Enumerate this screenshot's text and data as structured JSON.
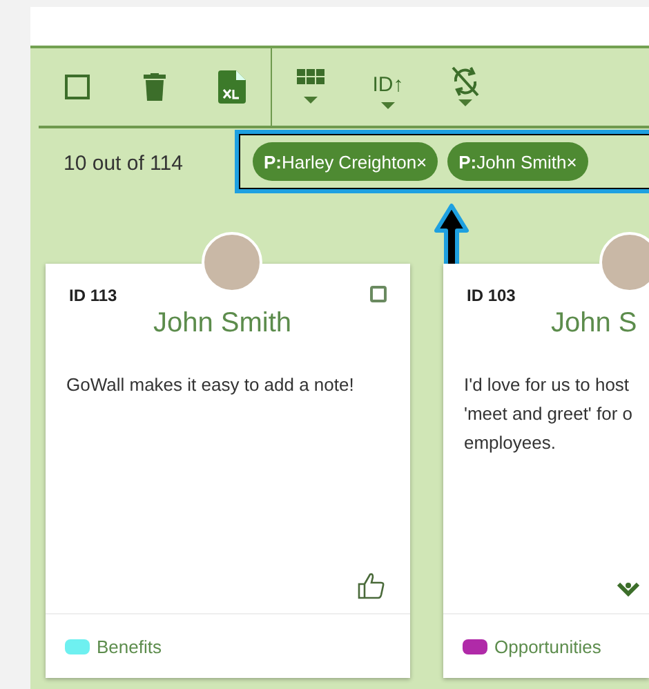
{
  "toolbar": {
    "select_all_checked": false,
    "sort_label": "ID↑"
  },
  "result_count": "10 out of 114",
  "filters": [
    {
      "prefix": "P:",
      "name": "Harley Creighton",
      "remove": "×"
    },
    {
      "prefix": "P:",
      "name": "John Smith",
      "remove": "×"
    }
  ],
  "cards": [
    {
      "id": "ID 113",
      "name": "John Smith",
      "checked": false,
      "note_lines": [
        "GoWall makes it easy to add a note!"
      ],
      "kind": "like",
      "tag": {
        "label": "Benefits",
        "color": "#6ef0f0"
      }
    },
    {
      "id": "ID 103",
      "name": "John S",
      "note_lines": [
        "I'd love for us to host",
        "'meet and greet' for o",
        "employees."
      ],
      "kind": "expand",
      "tag": {
        "label": "Opportunities",
        "color": "#b02aa8"
      }
    }
  ]
}
